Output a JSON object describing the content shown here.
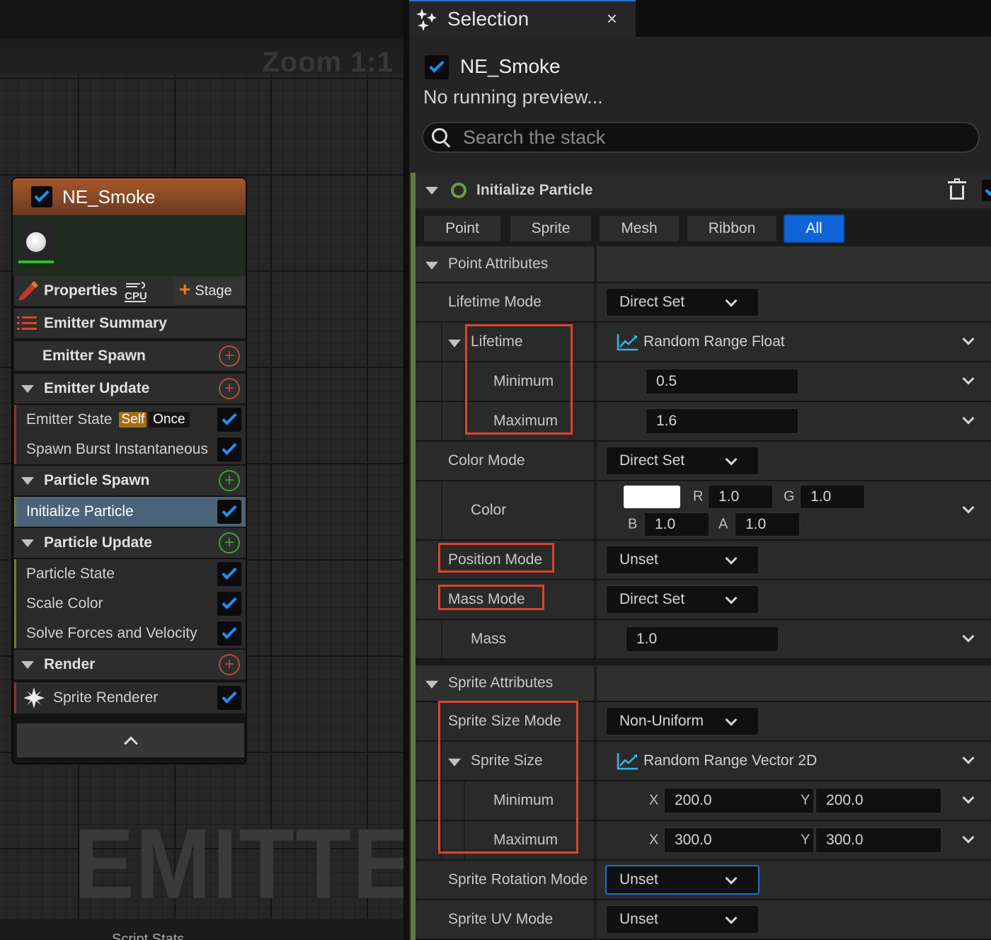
{
  "graph": {
    "zoom_label": "Zoom 1:1",
    "watermark": "EMITTER",
    "bottom_text": "Script Stats"
  },
  "node": {
    "title": "NE_Smoke",
    "properties_label": "Properties",
    "cpu_label": "CPU",
    "stage_label": "Stage",
    "emitter_summary": "Emitter Summary",
    "emitter_spawn": "Emitter Spawn",
    "emitter_update": "Emitter Update",
    "emitter_state": "Emitter State",
    "self_tag": "Self",
    "once_tag": "Once",
    "spawn_burst": "Spawn Burst Instantaneous",
    "particle_spawn": "Particle Spawn",
    "initialize_particle": "Initialize Particle",
    "particle_update": "Particle Update",
    "particle_state": "Particle State",
    "scale_color": "Scale Color",
    "solve_forces": "Solve Forces and Velocity",
    "render": "Render",
    "sprite_renderer": "Sprite Renderer",
    "colors": {
      "header": "#a9572a",
      "selected": "#4a6379",
      "check": "#1e90ff"
    }
  },
  "panel": {
    "tab_title": "Selection",
    "tab_close": "×",
    "selected_name": "NE_Smoke",
    "preview_text": "No running preview...",
    "search_placeholder": "Search the stack",
    "module_title": "Initialize Particle",
    "filters": [
      "Point",
      "Sprite",
      "Mesh",
      "Ribbon",
      "All"
    ],
    "active_filter": "All",
    "point_attributes": "Point Attributes",
    "lifetime_mode_label": "Lifetime Mode",
    "lifetime_mode_value": "Direct Set",
    "lifetime_label": "Lifetime",
    "lifetime_type": "Random Range Float",
    "minimum_label": "Minimum",
    "maximum_label": "Maximum",
    "lifetime_min": "0.5",
    "lifetime_max": "1.6",
    "color_mode_label": "Color Mode",
    "color_mode_value": "Direct Set",
    "color_label": "Color",
    "color_r_label": "R",
    "color_g_label": "G",
    "color_b_label": "B",
    "color_a_label": "A",
    "color_r": "1.0",
    "color_g": "1.0",
    "color_b": "1.0",
    "color_a": "1.0",
    "position_mode_label": "Position Mode",
    "position_mode_value": "Unset",
    "mass_mode_label": "Mass Mode",
    "mass_mode_value": "Direct Set",
    "mass_label": "Mass",
    "mass_value": "1.0",
    "sprite_attributes": "Sprite Attributes",
    "sprite_size_mode_label": "Sprite Size Mode",
    "sprite_size_mode_value": "Non-Uniform",
    "sprite_size_label": "Sprite Size",
    "sprite_size_type": "Random Range Vector 2D",
    "x_label": "X",
    "y_label": "Y",
    "size_min_x": "200.0",
    "size_min_y": "200.0",
    "size_max_x": "300.0",
    "size_max_y": "300.0",
    "sprite_rotation_mode_label": "Sprite Rotation Mode",
    "sprite_rotation_mode_value": "Unset",
    "sprite_uv_mode_label": "Sprite UV Mode",
    "sprite_uv_mode_value": "Unset",
    "colors": {
      "accent": "#1164d8",
      "highlight": "#d9442e",
      "module_bar": "#5f7b3b",
      "curve_icon": "#2fb7e8"
    }
  }
}
